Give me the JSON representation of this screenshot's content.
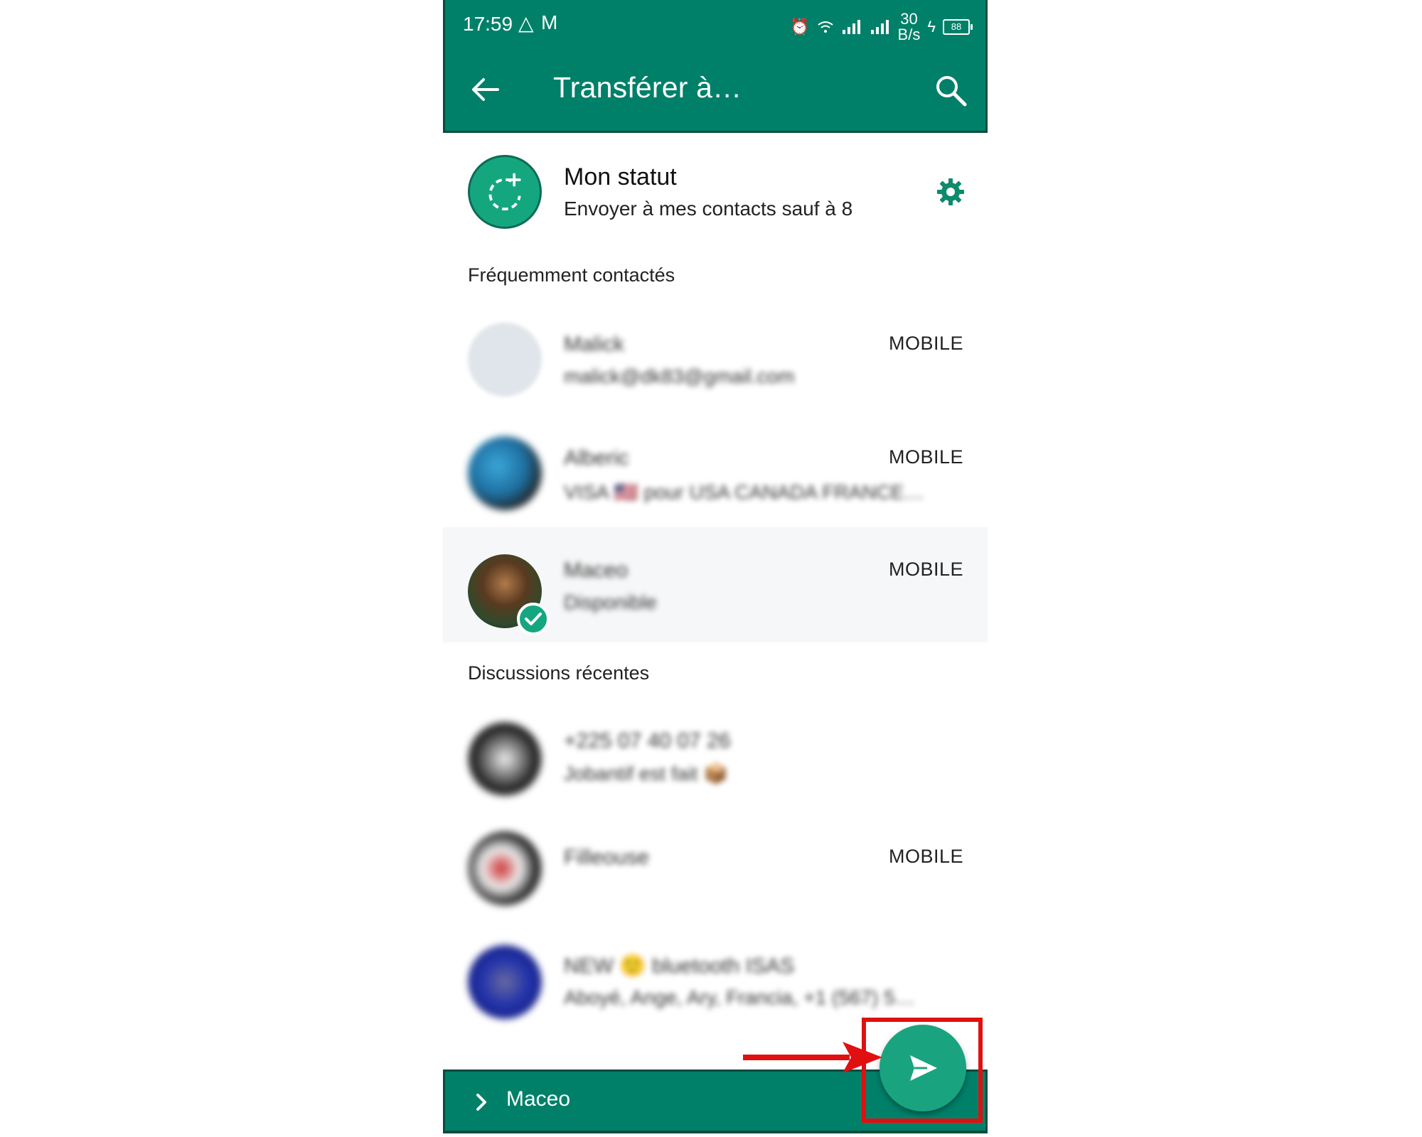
{
  "status_bar": {
    "time": "17:59",
    "left_icons": [
      "warning-icon",
      "gmail-icon"
    ],
    "speed_top": "30",
    "speed_bottom": "B/s",
    "battery": "88",
    "right_icons": [
      "alarm-icon",
      "wifi-icon",
      "signal-icon",
      "signal-icon",
      "charging-icon",
      "battery-icon"
    ]
  },
  "header": {
    "title": "Transférer à…",
    "back_icon": "arrow-left-icon",
    "search_icon": "search-icon",
    "color": "#008069"
  },
  "my_status": {
    "name": "Mon statut",
    "subtitle": "Envoyer à mes contacts sauf à 8",
    "icon": "status-add-icon",
    "settings_icon": "gear-icon"
  },
  "sections": {
    "frequent": "Fréquemment contactés",
    "recent": "Discussions récentes"
  },
  "frequent_contacts": [
    {
      "name": "Malick",
      "subtitle": "malick@dk83@gmail.com",
      "type": "MOBILE",
      "selected": false
    },
    {
      "name": "Alberic",
      "subtitle": "VISA 🇺🇸 pour USA CANADA FRANCE…",
      "type": "MOBILE",
      "selected": false
    },
    {
      "name": "Maceo",
      "subtitle": "Disponible",
      "type": "MOBILE",
      "selected": true
    }
  ],
  "recent_chats": [
    {
      "name": "+225 07 40 07 26",
      "subtitle": "Jobantif est fait 📦",
      "type": ""
    },
    {
      "name": "Filleouse",
      "subtitle": "",
      "type": "MOBILE"
    },
    {
      "name": "NEW 🙂 bluetooth ISAS",
      "subtitle": "Aboyé, Ange, Ary, Francia, +1 (567) 5…",
      "type": ""
    }
  ],
  "bottom_bar": {
    "selected": "Maceo",
    "chevron_icon": "chevron-right-icon"
  },
  "fab": {
    "icon": "send-icon",
    "color": "#19a37f"
  },
  "annotation": {
    "arrow_color": "#e01010",
    "box_color": "#e01010"
  }
}
